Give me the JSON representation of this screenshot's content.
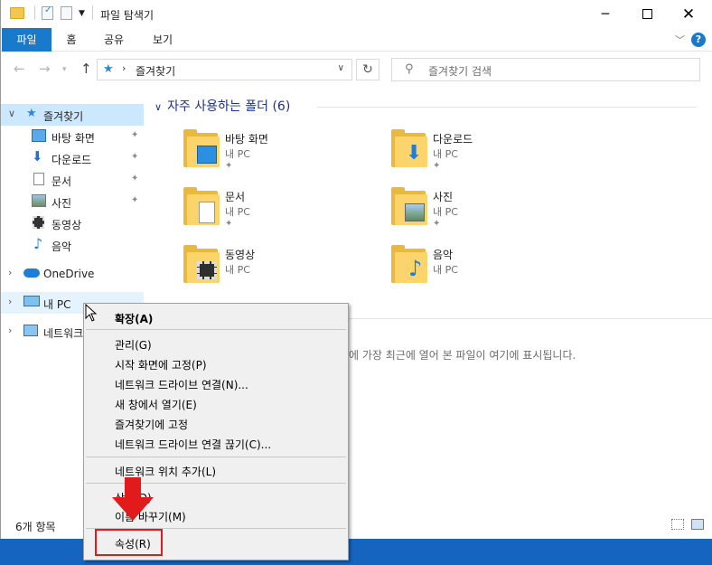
{
  "titlebar": {
    "title": "파일 탐색기",
    "minimize_icon": "minimize-icon",
    "maximize_icon": "maximize-icon",
    "close_icon": "close-icon"
  },
  "ribbon": {
    "tabs": [
      "파일",
      "홈",
      "공유",
      "보기"
    ],
    "help_label": "?"
  },
  "navigation": {
    "address_path": "즐겨찾기",
    "search_placeholder": "즐겨찾기 검색"
  },
  "sidebar": {
    "quick_access": "즐겨찾기",
    "pinned": [
      "바탕 화면",
      "다운로드",
      "문서",
      "사진"
    ],
    "unpinned": [
      "동영상",
      "음악"
    ],
    "onedrive": "OneDrive",
    "this_pc": "내 PC",
    "network": "네트워크"
  },
  "main": {
    "section_title": "자주 사용하는 폴더 (6)",
    "folders": [
      {
        "name": "바탕 화면",
        "location": "내 PC",
        "pinned": true,
        "icon": "desktop-folder-icon"
      },
      {
        "name": "다운로드",
        "location": "내 PC",
        "pinned": true,
        "icon": "downloads-folder-icon"
      },
      {
        "name": "문서",
        "location": "내 PC",
        "pinned": true,
        "icon": "documents-folder-icon"
      },
      {
        "name": "사진",
        "location": "내 PC",
        "pinned": true,
        "icon": "pictures-folder-icon"
      },
      {
        "name": "동영상",
        "location": "내 PC",
        "pinned": false,
        "icon": "videos-folder-icon"
      },
      {
        "name": "음악",
        "location": "내 PC",
        "pinned": false,
        "icon": "music-folder-icon"
      }
    ],
    "recent_message": "에 가장 최근에 열어 본 파일이 여기에 표시됩니다."
  },
  "status": {
    "item_count": "6개 항목"
  },
  "context_menu": {
    "items": [
      "확장(A)",
      "관리(G)",
      "시작 화면에 고정(P)",
      "네트워크 드라이브 연결(N)...",
      "새 창에서 열기(E)",
      "즐겨찾기에 고정",
      "네트워크 드라이브 연결 끊기(C)...",
      "네트워크 위치 추가(L)",
      "삭제(D)",
      "이름 바꾸기(M)",
      "속성(R)"
    ]
  },
  "colors": {
    "accent": "#1979ca",
    "selection": "#cce8ff",
    "highlight_box": "#e11b1b"
  }
}
